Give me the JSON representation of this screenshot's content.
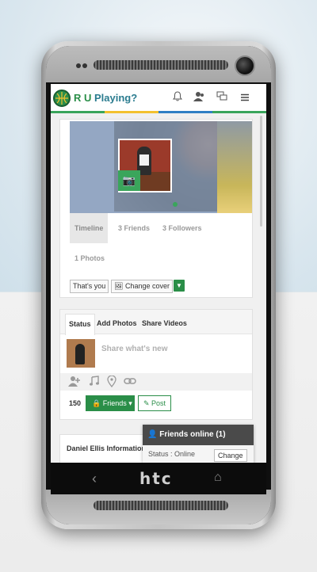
{
  "device": {
    "brand": "htc"
  },
  "app": {
    "logo_text_1": "R U",
    "logo_text_2": "Playing?"
  },
  "header_icons": [
    "bell-icon",
    "user-icon",
    "chat-icon",
    "menu-icon"
  ],
  "profile": {
    "tabs": [
      "Timeline",
      "3 Friends",
      "3 Followers",
      "1 Photos"
    ],
    "buttons": {
      "thats_you": "That's you",
      "change_cover": "Change cover"
    }
  },
  "composer": {
    "tabs": [
      "Status",
      "Add Photos",
      "Share Videos"
    ],
    "placeholder": "Share what's new",
    "tools": [
      "add-user-icon",
      "music-icon",
      "location-icon",
      "link-icon"
    ],
    "count": "150",
    "friends_label": "Friends",
    "post_label": "Post"
  },
  "info": {
    "title": "Daniel Ellis Information"
  },
  "online": {
    "title": "Friends online (1)",
    "status_text": "Status : Online",
    "change_label": "Change"
  },
  "nav": {
    "back": "‹",
    "home": "⌂"
  },
  "colors": {
    "brand_green": "#2a8e48",
    "nav_dark": "#4a4a4a"
  }
}
